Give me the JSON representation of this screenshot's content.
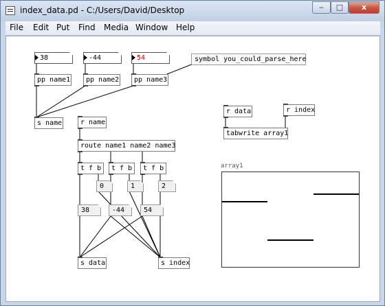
{
  "window": {
    "title": "index_data.pd  -  C:/Users/David/Desktop",
    "buttons": {
      "minimize": "‒",
      "maximize": "□",
      "close": "x"
    }
  },
  "menubar": {
    "items": [
      "File",
      "Edit",
      "Put",
      "Find",
      "Media",
      "Window",
      "Help"
    ]
  },
  "patch": {
    "symbol_atoms": [
      {
        "value": "38",
        "color": "#000000"
      },
      {
        "value": "-44",
        "color": "#000000"
      },
      {
        "value": "54",
        "color": "#cc0000"
      }
    ],
    "message": "symbol you_could_parse_here",
    "pp_objects": [
      "pp name1",
      "pp name2",
      "pp name3"
    ],
    "s_name": "s name",
    "r_name": "r name",
    "route": "route name1 name2 name3",
    "trigger": "t f b",
    "index_numbers": [
      "0",
      "1",
      "2"
    ],
    "value_numbers": [
      "38",
      "-44",
      "54"
    ],
    "s_data": "s data",
    "s_index": "s index",
    "r_data": "r data",
    "r_index": "r index",
    "tabwrite": "tabwrite array1",
    "array": {
      "label": "array1",
      "values": [
        38,
        -44,
        54
      ]
    }
  }
}
